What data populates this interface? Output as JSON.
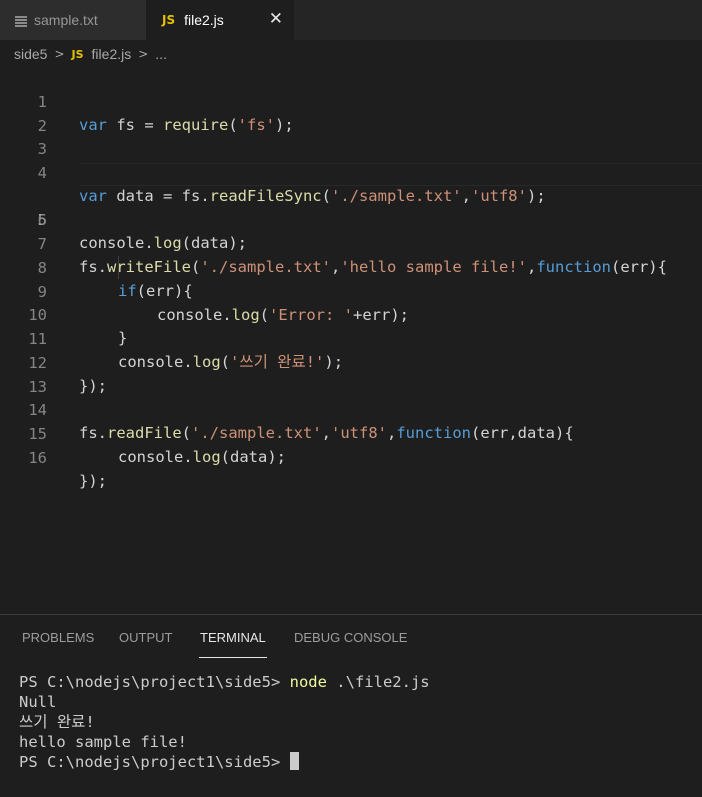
{
  "tabs": [
    {
      "label": "sample.txt",
      "icon": "text-file-icon",
      "active": false
    },
    {
      "label": "file2.js",
      "icon": "js-file-icon",
      "icon_text": "JS",
      "active": true,
      "close": "✕"
    }
  ],
  "breadcrumb": {
    "folder": "side5",
    "file_icon": "JS",
    "file": "file2.js",
    "more": "..."
  },
  "editor": {
    "active_line": 5,
    "lines": [
      {
        "n": "1"
      },
      {
        "n": "2"
      },
      {
        "n": "3"
      },
      {
        "n": "4"
      },
      {
        "n": "5"
      },
      {
        "n": "6"
      },
      {
        "n": "7"
      },
      {
        "n": "8"
      },
      {
        "n": "9"
      },
      {
        "n": "10"
      },
      {
        "n": "11"
      },
      {
        "n": "12"
      },
      {
        "n": "13"
      },
      {
        "n": "14"
      },
      {
        "n": "15"
      },
      {
        "n": "16"
      }
    ],
    "code": {
      "l1": {
        "kw": "var",
        "a": " fs = ",
        "fn": "require",
        "b": "(",
        "s": "'fs'",
        "c": ");"
      },
      "l4": {
        "kw": "var",
        "a": " data = fs.",
        "fn": "readFileSync",
        "b": "(",
        "s1": "'./sample.txt'",
        "c": ",",
        "s2": "'utf8'",
        "d": ");"
      },
      "l5": {
        "a": "console.",
        "fn": "log",
        "b": "(data);"
      },
      "l7": {
        "a": "fs.",
        "fn": "writeFile",
        "b": "(",
        "s1": "'./sample.txt'",
        "c": ",",
        "s2": "'hello sample file!'",
        "d": ",",
        "kw": "function",
        "e": "(err){"
      },
      "l8": {
        "kw": "if",
        "a": "(err){"
      },
      "l9": {
        "a": "console.",
        "fn": "log",
        "b": "(",
        "s": "'Error: '",
        "c": "+err);"
      },
      "l10": {
        "a": "}"
      },
      "l11": {
        "a": "console.",
        "fn": "log",
        "b": "(",
        "s": "'쓰기 완료!'",
        "c": ");"
      },
      "l12": {
        "a": "});"
      },
      "l14": {
        "a": "fs.",
        "fn": "readFile",
        "b": "(",
        "s1": "'./sample.txt'",
        "c": ",",
        "s2": "'utf8'",
        "d": ",",
        "kw": "function",
        "e": "(err,data){"
      },
      "l15": {
        "a": "console.",
        "fn": "log",
        "b": "(data);"
      },
      "l16": {
        "a": "});"
      }
    }
  },
  "panel": {
    "tabs": [
      "PROBLEMS",
      "OUTPUT",
      "TERMINAL",
      "DEBUG CONSOLE"
    ],
    "active_tab": "TERMINAL"
  },
  "terminal": {
    "prompt1": "PS C:\\nodejs\\project1\\side5> ",
    "cmd": "node",
    "args": " .\\file2.js",
    "out1": "Null",
    "out2": "쓰기 완료!",
    "out3": "hello sample file!",
    "prompt2": "PS C:\\nodejs\\project1\\side5> "
  },
  "colors": {
    "keyword": "#569cd6",
    "string": "#ce9178",
    "function": "#dcdcaa",
    "text": "#d4d4d4",
    "background": "#1e1e1e"
  }
}
